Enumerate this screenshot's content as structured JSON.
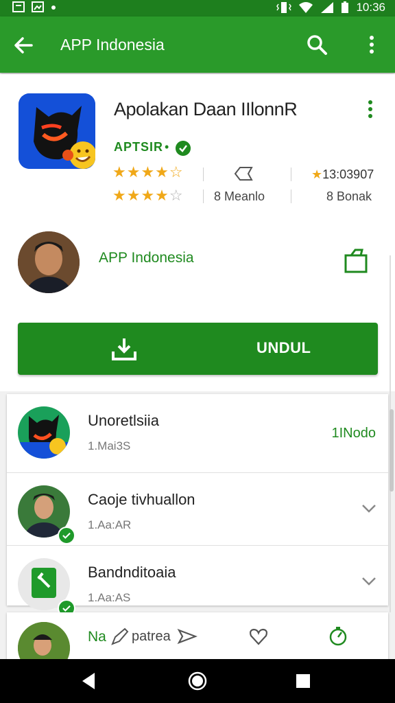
{
  "status_bar": {
    "time": "10:36"
  },
  "app_bar": {
    "title": "APP Indonesia"
  },
  "app": {
    "name": "Apolakan Daan IIlonnR",
    "developer": "APTSIR",
    "developer_dot": "•",
    "rating_stars_1": 4.5,
    "rating_stars_2": 4,
    "stat_value": "13:03907",
    "stat_downloads": "8 Meanlo",
    "stat_count": "8 Bonak"
  },
  "publisher": {
    "name": "APP Indonesia"
  },
  "install": {
    "label": "UNDUL"
  },
  "related": [
    {
      "name": "Unoretlsiia",
      "sub": "1.Mai3S",
      "right": "1INodo"
    },
    {
      "name": "Caoje tivhuallon",
      "sub": "1.Aa:AR"
    },
    {
      "name": "Bandnditoaia",
      "sub": "1.Aa:AS"
    }
  ],
  "bottom_item": {
    "name": "Na",
    "name2": "patrea"
  },
  "colors": {
    "primary": "#2a9a2a",
    "primary_dark": "#1e7f1e",
    "star": "#f0a818"
  }
}
